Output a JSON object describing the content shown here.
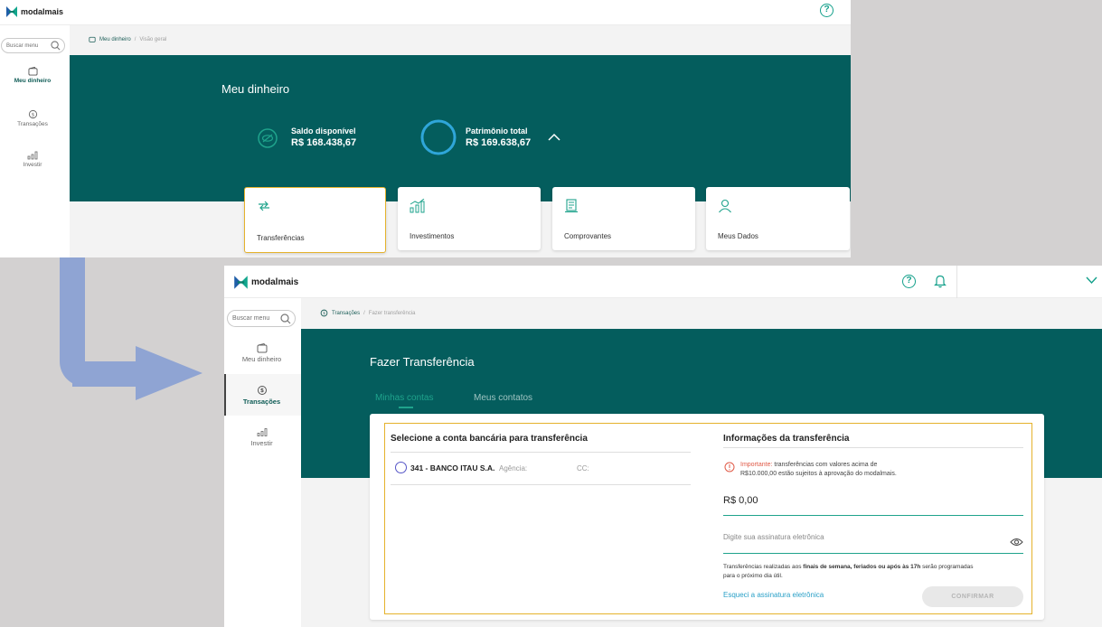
{
  "screen1": {
    "brand": "modalmais",
    "help_icon": "help-circle-icon",
    "search_placeholder": "Buscar menu",
    "sidebar": [
      {
        "label": "Meu dinheiro",
        "icon": "wallet-icon",
        "active": true
      },
      {
        "label": "Transações",
        "icon": "transactions-icon",
        "active": false
      },
      {
        "label": "Investir",
        "icon": "chart-icon",
        "active": false
      }
    ],
    "breadcrumb": {
      "root": "Meu dinheiro",
      "sep": "/",
      "current": "Visão geral"
    },
    "title": "Meu dinheiro",
    "saldo": {
      "label": "Saldo disponível",
      "value": "R$ 168.438,67"
    },
    "patrimonio": {
      "label": "Patrimônio total",
      "value": "R$ 169.638,67"
    },
    "cards": [
      {
        "label": "Transferências",
        "icon": "transfer-icon",
        "highlighted": true
      },
      {
        "label": "Investimentos",
        "icon": "chart-icon",
        "highlighted": false
      },
      {
        "label": "Comprovantes",
        "icon": "receipt-icon",
        "highlighted": false
      },
      {
        "label": "Meus Dados",
        "icon": "user-icon",
        "highlighted": false
      }
    ]
  },
  "screen2": {
    "brand": "modalmais",
    "search_placeholder": "Buscar menu",
    "sidebar": [
      {
        "label": "Meu dinheiro",
        "icon": "wallet-icon",
        "active": false
      },
      {
        "label": "Transações",
        "icon": "transactions-icon",
        "active": true
      },
      {
        "label": "Investir",
        "icon": "chart-icon",
        "active": false
      }
    ],
    "breadcrumb": {
      "root": "Transações",
      "sep": "/",
      "current": "Fazer transferência"
    },
    "title": "Fazer Transferência",
    "tabs": [
      {
        "label": "Minhas contas",
        "active": true
      },
      {
        "label": "Meus contatos",
        "active": false
      }
    ],
    "left_panel": {
      "heading": "Selecione a conta bancária para transferência",
      "account": {
        "bank": "341 - BANCO ITAU S.A.",
        "agencia_label": "Agência:",
        "cc_label": "CC:"
      }
    },
    "right_panel": {
      "heading": "Informações da transferência",
      "notice_strong": "Importante:",
      "notice_line1": "transferências com valores acima de",
      "notice_line2": "R$10.000,00 estão sujeitos à aprovação do modalmais.",
      "amount": "R$ 0,00",
      "signature_placeholder": "Digite sua assinatura eletrônica",
      "info_prefix": "Transferências realizadas aos",
      "info_bold": "finais de semana, feriados ou após às 17h",
      "info_suffix": "serão programadas",
      "info_line2": "para o próximo dia útil.",
      "forgot_link": "Esqueci a assinatura eletrônica",
      "confirm_button": "CONFIRMAR"
    }
  },
  "colors": {
    "teal_dark": "#045d5d",
    "accent": "#1fa38c",
    "highlight": "#e5b22c",
    "arrow": "#8fa4d3",
    "notice": "#e05a47"
  }
}
